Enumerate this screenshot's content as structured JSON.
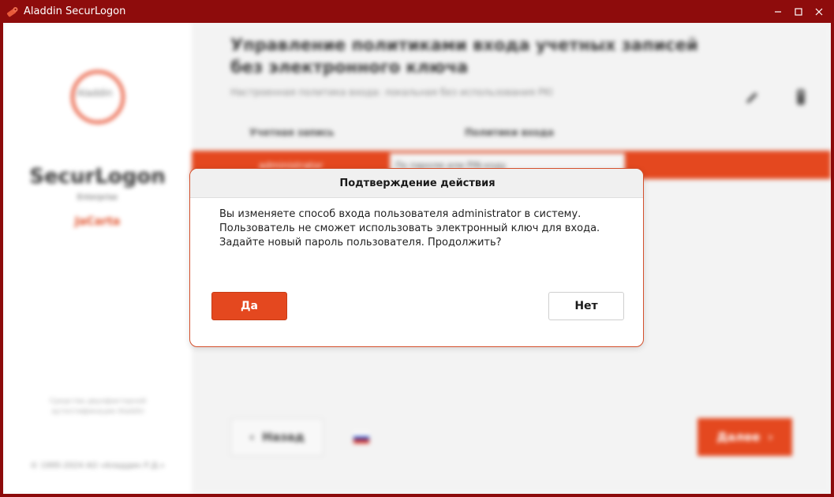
{
  "window": {
    "title": "Aladdin SecurLogon",
    "icon": "key-icon",
    "controls": [
      "minimize-icon",
      "maximize-icon",
      "close-icon"
    ]
  },
  "sidebar": {
    "logo_text": "Aladdin",
    "brand_name": "SecurLogon",
    "edition": "Enterprise",
    "vendor": "JaCarta",
    "note": "Средства двухфакторной аутентификации Aladdin",
    "copyright": "© 1995-2024 АО «Аладдин Р.Д.»"
  },
  "main": {
    "title": "Управление политиками входа учетных записей без электронного ключа",
    "subtitle": "Настроенная политика входа: локальная без использования PKI",
    "columns": {
      "account": "Учетная запись",
      "policy": "Политики входа"
    },
    "row": {
      "account": "administrator",
      "policy": "По паролю или PIN-коду"
    },
    "back_label": "Назад",
    "next_label": "Далее"
  },
  "dialog": {
    "title": "Подтверждение действия",
    "message": "Вы изменяете способ входа пользователя administrator в систему. Пользователь не сможет использовать электронный ключ для входа. Задайте новый пароль пользователя. Продолжить?",
    "yes_label": "Да",
    "no_label": "Нет"
  },
  "colors": {
    "accent": "#e4481f",
    "titlebar": "#8e0c0c"
  }
}
